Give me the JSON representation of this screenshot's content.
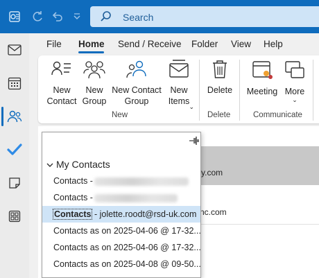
{
  "titlebar": {
    "search_placeholder": "Search",
    "accent": "#0f6cbd"
  },
  "tabs": [
    {
      "label": "File"
    },
    {
      "label": "Home"
    },
    {
      "label": "Send / Receive"
    },
    {
      "label": "Folder"
    },
    {
      "label": "View"
    },
    {
      "label": "Help"
    }
  ],
  "ribbon": {
    "new_contact": "New Contact",
    "new_group": "New Group",
    "new_contact_group": "New Contact Group",
    "new_items": "New Items",
    "delete": "Delete",
    "meeting": "Meeting",
    "more": "More",
    "groups": {
      "new": "New",
      "delete": "Delete",
      "communicate": "Communicate"
    }
  },
  "content": {
    "snippet1": "y.com",
    "snippet2": "nc.com"
  },
  "dropdown": {
    "header": "My Contacts",
    "items": [
      {
        "text": "Contacts -",
        "blurred": true
      },
      {
        "text": "Contacts -",
        "blurred": true
      },
      {
        "bold": "Contacts",
        "rest": " - jolette.roodt@rsd-uk.com",
        "selected": true
      },
      {
        "text": "Contacts as on 2025-04-06 @ 17-32..."
      },
      {
        "text": "Contacts as on 2025-04-06 @ 17-32..."
      },
      {
        "text": "Contacts as on 2025-04-08 @ 09-50..."
      }
    ]
  }
}
